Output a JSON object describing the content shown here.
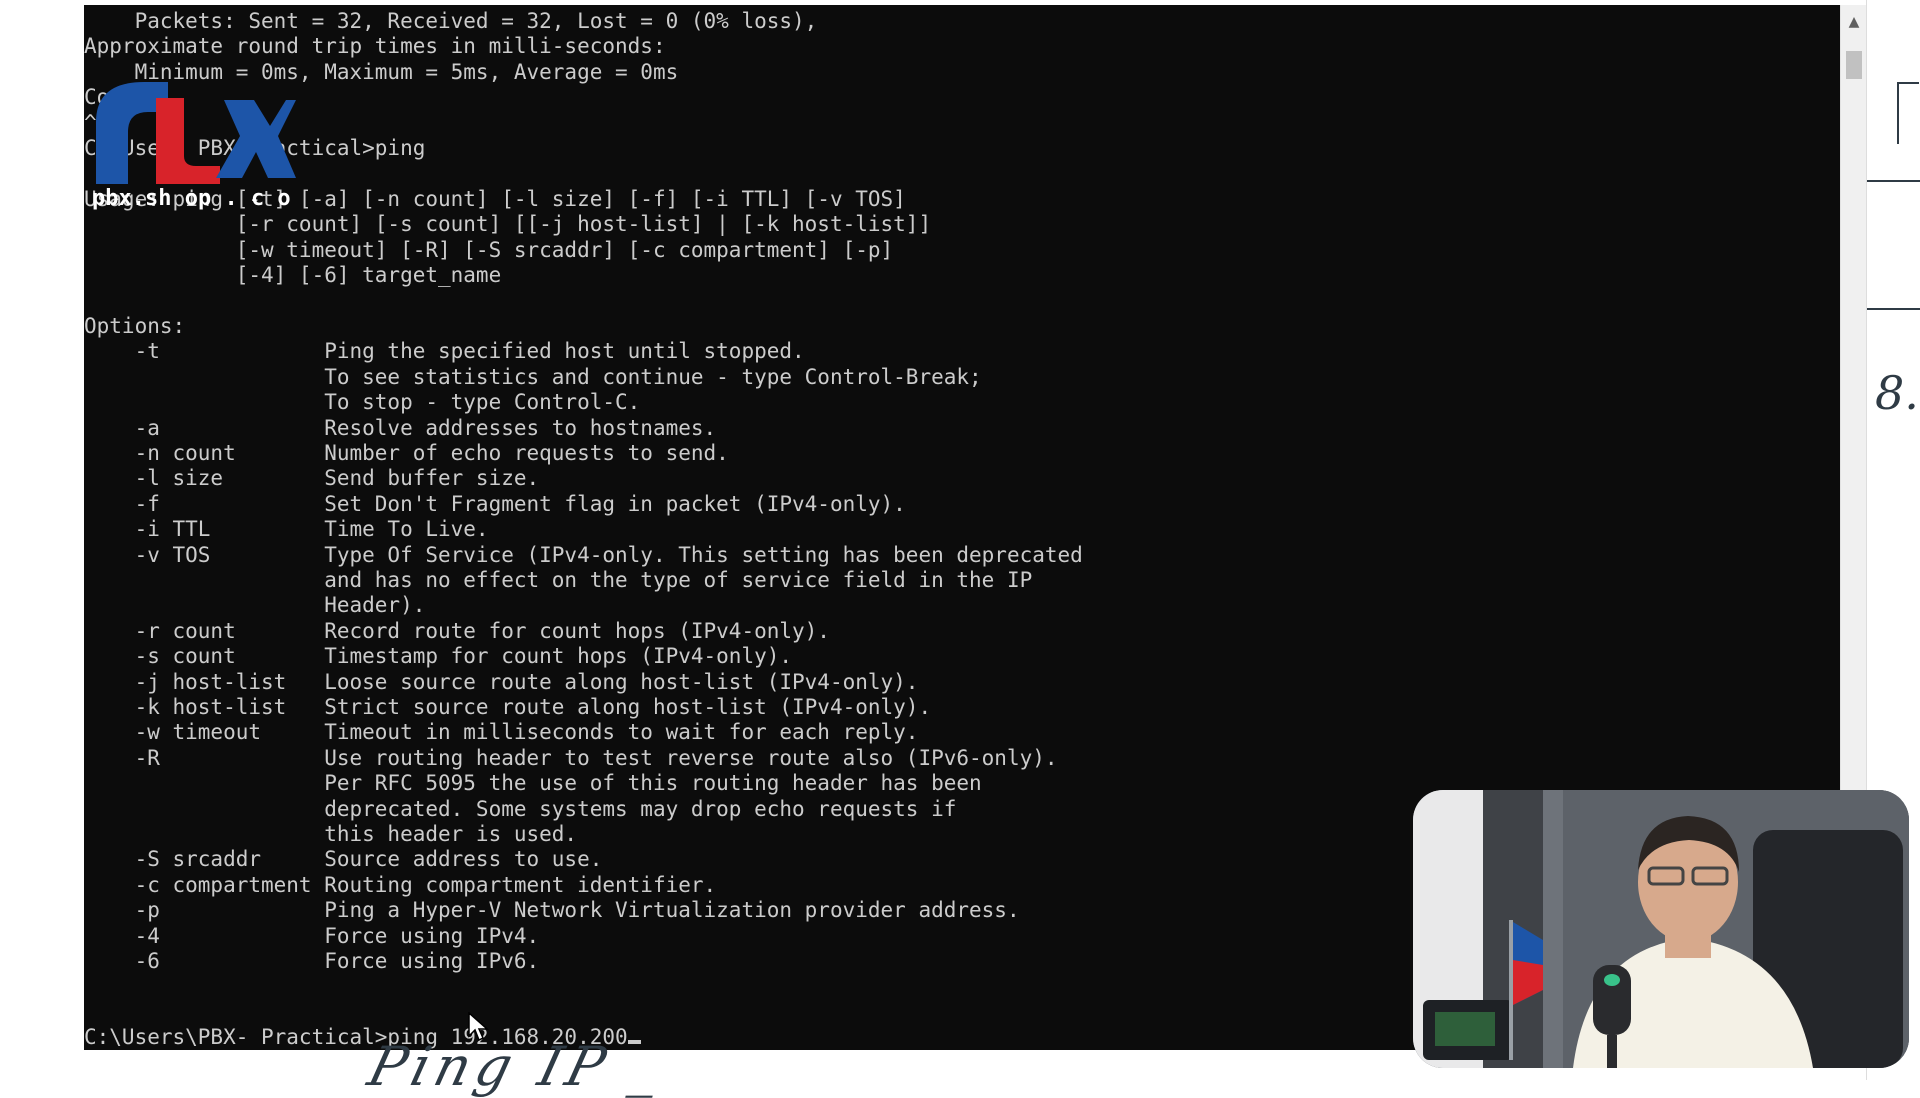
{
  "console": {
    "lines": [
      "    Packets: Sent = 32, Received = 32, Lost = 0 (0% loss),",
      "Approximate round trip times in milli-seconds:",
      "    Minimum = 0ms, Maximum = 5ms, Average = 0ms",
      "Co",
      "^",
      "C  Use   PBX  ractical>ping",
      "",
      "Usage: ping [-t] [-a] [-n count] [-l size] [-f] [-i TTL] [-v TOS]",
      "            [-r count] [-s count] [[-j host-list] | [-k host-list]]",
      "            [-w timeout] [-R] [-S srcaddr] [-c compartment] [-p]",
      "            [-4] [-6] target_name",
      "",
      "Options:",
      "    -t             Ping the specified host until stopped.",
      "                   To see statistics and continue - type Control-Break;",
      "                   To stop - type Control-C.",
      "    -a             Resolve addresses to hostnames.",
      "    -n count       Number of echo requests to send.",
      "    -l size        Send buffer size.",
      "    -f             Set Don't Fragment flag in packet (IPv4-only).",
      "    -i TTL         Time To Live.",
      "    -v TOS         Type Of Service (IPv4-only. This setting has been deprecated",
      "                   and has no effect on the type of service field in the IP",
      "                   Header).",
      "    -r count       Record route for count hops (IPv4-only).",
      "    -s count       Timestamp for count hops (IPv4-only).",
      "    -j host-list   Loose source route along host-list (IPv4-only).",
      "    -k host-list   Strict source route along host-list (IPv4-only).",
      "    -w timeout     Timeout in milliseconds to wait for each reply.",
      "    -R             Use routing header to test reverse route also (IPv6-only).",
      "                   Per RFC 5095 the use of this routing header has been",
      "                   deprecated. Some systems may drop echo requests if",
      "                   this header is used.",
      "    -S srcaddr     Source address to use.",
      "    -c compartment Routing compartment identifier.",
      "    -p             Ping a Hyper-V Network Virtualization provider address.",
      "    -4             Force using IPv4.",
      "    -6             Force using IPv6.",
      "",
      ""
    ],
    "prompt": "C:\\Users\\PBX- Practical>ping 192.168.20.200"
  },
  "watermark": {
    "caption": "pbx.sh op . c o"
  },
  "whiteboard": {
    "handwriting": "Ping  IP _",
    "side_mark": "8."
  },
  "icons": {
    "scroll_up": "scroll-up-icon",
    "pointer": "mouse-pointer-icon",
    "logo": "logo-icon"
  },
  "colors": {
    "console_bg": "#0c0c0c",
    "console_text": "#cccccc",
    "logo_blue": "#1d55a8",
    "logo_red": "#d8232a"
  }
}
